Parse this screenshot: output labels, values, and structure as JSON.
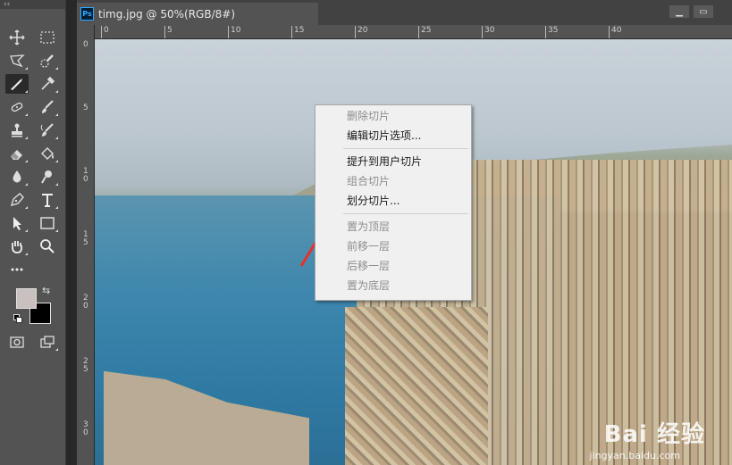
{
  "document": {
    "tab_title": "timg.jpg @ 50%(RGB/8#)",
    "ps_badge": "Ps",
    "minimize": "▁",
    "maximize": "▭"
  },
  "toolbar": {
    "collapse": "‹‹",
    "tools": [
      {
        "name": "move-tool",
        "icon": "move-icon"
      },
      {
        "name": "marquee-tool",
        "icon": "rect-marquee-icon"
      },
      {
        "name": "lasso-tool",
        "icon": "polygonal-lasso-icon"
      },
      {
        "name": "quick-select-tool",
        "icon": "quick-select-icon"
      },
      {
        "name": "slice-tool",
        "icon": "slice-icon",
        "active": true
      },
      {
        "name": "eyedropper-tool",
        "icon": "eyedropper-icon"
      },
      {
        "name": "healing-tool",
        "icon": "healing-brush-icon"
      },
      {
        "name": "brush-tool",
        "icon": "brush-icon"
      },
      {
        "name": "stamp-tool",
        "icon": "clone-stamp-icon"
      },
      {
        "name": "history-brush-tool",
        "icon": "history-brush-icon"
      },
      {
        "name": "eraser-tool",
        "icon": "eraser-icon"
      },
      {
        "name": "paint-bucket-tool",
        "icon": "paint-bucket-icon"
      },
      {
        "name": "blur-tool",
        "icon": "blur-icon"
      },
      {
        "name": "dodge-tool",
        "icon": "dodge-icon"
      },
      {
        "name": "pen-tool",
        "icon": "pen-icon"
      },
      {
        "name": "type-tool",
        "icon": "type-icon"
      },
      {
        "name": "path-select-tool",
        "icon": "path-selection-icon"
      },
      {
        "name": "shape-tool",
        "icon": "rectangle-shape-icon"
      },
      {
        "name": "hand-tool",
        "icon": "hand-icon"
      },
      {
        "name": "zoom-tool",
        "icon": "zoom-icon"
      },
      {
        "name": "more-tools",
        "icon": "ellipsis-icon"
      }
    ],
    "foreground_color": "#c9c0c0",
    "background_color": "#000000"
  },
  "rulers": {
    "horizontal": [
      "0",
      "5",
      "10",
      "15",
      "20",
      "25",
      "30",
      "35",
      "40"
    ],
    "vertical": [
      "0",
      "5",
      "1\n0",
      "1\n5",
      "2\n0",
      "2\n5",
      "3\n0"
    ]
  },
  "context_menu": {
    "items": [
      {
        "label": "删除切片",
        "enabled": false
      },
      {
        "label": "编辑切片选项...",
        "enabled": true
      },
      {
        "label": "提升到用户切片",
        "enabled": true
      },
      {
        "label": "组合切片",
        "enabled": false
      },
      {
        "label": "划分切片...",
        "enabled": true
      },
      {
        "label": "置为顶层",
        "enabled": false
      },
      {
        "label": "前移一层",
        "enabled": false
      },
      {
        "label": "后移一层",
        "enabled": false
      },
      {
        "label": "置为底层",
        "enabled": false
      }
    ]
  },
  "watermark": {
    "text": "Bai 经验",
    "url": "jingyan.baidu.com"
  },
  "colors": {
    "app_bg": "#282828",
    "panel": "#535353",
    "accent_ps": "#31a8ff",
    "annotation_arrow": "#e8312a"
  }
}
